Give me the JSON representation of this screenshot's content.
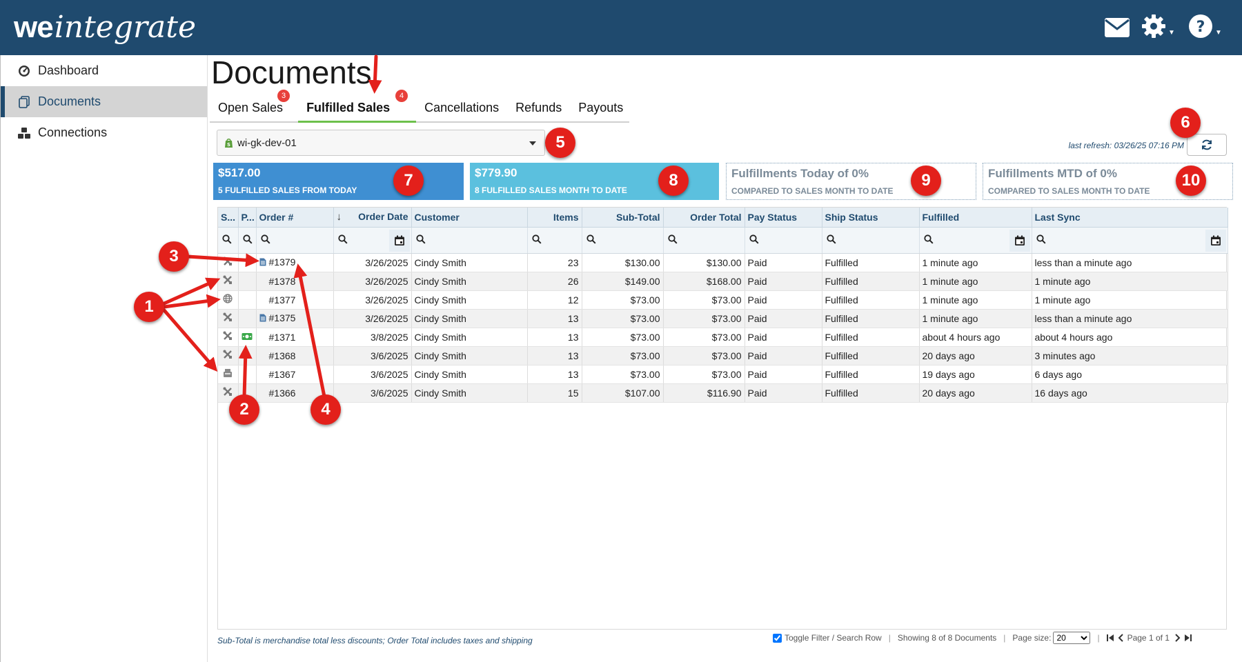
{
  "app": {
    "logo_we": "we",
    "logo_rest": "integrate",
    "icons": {
      "mail": "mail-icon",
      "settings": "gear-icon",
      "help": "help-icon"
    },
    "colors": {
      "brand": "#1f4a6e",
      "accent_green": "#6dc04b",
      "badge_red": "#e8403a"
    }
  },
  "sidebar": {
    "items": [
      {
        "label": "Dashboard",
        "icon": "dashboard-icon"
      },
      {
        "label": "Documents",
        "icon": "documents-icon"
      },
      {
        "label": "Connections",
        "icon": "connections-icon"
      }
    ]
  },
  "page": {
    "title": "Documents"
  },
  "tabs": [
    {
      "label": "Open Sales",
      "badge": "3"
    },
    {
      "label": "Fulfilled Sales",
      "badge": "4"
    },
    {
      "label": "Cancellations"
    },
    {
      "label": "Refunds"
    },
    {
      "label": "Payouts"
    }
  ],
  "store_select": {
    "value": "wi-gk-dev-01",
    "icon": "shopify-icon"
  },
  "refresh": {
    "text": "last refresh: 03/26/25 07:16 PM"
  },
  "kpis": [
    {
      "value": "$517.00",
      "label": "5 FULFILLED SALES FROM TODAY",
      "color": "#3f8fd2"
    },
    {
      "value": "$779.90",
      "label": "8 FULFILLED SALES MONTH TO DATE",
      "color": "#5bc0de"
    },
    {
      "value": "Fulfillments Today of 0%",
      "label": "COMPARED TO SALES MONTH TO DATE"
    },
    {
      "value": "Fulfillments MTD of 0%",
      "label": "COMPARED TO SALES MONTH TO DATE"
    }
  ],
  "table": {
    "columns": [
      "S...",
      "P...",
      "Order #",
      "Order Date",
      "Customer",
      "Items",
      "Sub-Total",
      "Order Total",
      "Pay Status",
      "Ship Status",
      "Fulfilled",
      "Last Sync"
    ],
    "sort_indicator": "↓",
    "rows": [
      {
        "status_icon": "tools-icon",
        "pay_icon": "",
        "has_doc": true,
        "order": "#1379",
        "date": "3/26/2025",
        "customer": "Cindy Smith",
        "items": "23",
        "subtotal": "$130.00",
        "total": "$130.00",
        "pay": "Paid",
        "ship": "Fulfilled",
        "fulfilled": "1 minute ago",
        "sync": "less than a minute ago"
      },
      {
        "status_icon": "tools-icon",
        "pay_icon": "",
        "has_doc": false,
        "order": "#1378",
        "date": "3/26/2025",
        "customer": "Cindy Smith",
        "items": "26",
        "subtotal": "$149.00",
        "total": "$168.00",
        "pay": "Paid",
        "ship": "Fulfilled",
        "fulfilled": "1 minute ago",
        "sync": "1 minute ago"
      },
      {
        "status_icon": "globe-icon",
        "pay_icon": "",
        "has_doc": false,
        "order": "#1377",
        "date": "3/26/2025",
        "customer": "Cindy Smith",
        "items": "12",
        "subtotal": "$73.00",
        "total": "$73.00",
        "pay": "Paid",
        "ship": "Fulfilled",
        "fulfilled": "1 minute ago",
        "sync": "1 minute ago"
      },
      {
        "status_icon": "tools-icon",
        "pay_icon": "",
        "has_doc": true,
        "order": "#1375",
        "date": "3/26/2025",
        "customer": "Cindy Smith",
        "items": "13",
        "subtotal": "$73.00",
        "total": "$73.00",
        "pay": "Paid",
        "ship": "Fulfilled",
        "fulfilled": "1 minute ago",
        "sync": "less than a minute ago"
      },
      {
        "status_icon": "tools-icon",
        "pay_icon": "cash-icon",
        "has_doc": false,
        "order": "#1371",
        "date": "3/8/2025",
        "customer": "Cindy Smith",
        "items": "13",
        "subtotal": "$73.00",
        "total": "$73.00",
        "pay": "Paid",
        "ship": "Fulfilled",
        "fulfilled": "about 4 hours ago",
        "sync": "about 4 hours ago"
      },
      {
        "status_icon": "tools-icon",
        "pay_icon": "",
        "has_doc": false,
        "order": "#1368",
        "date": "3/6/2025",
        "customer": "Cindy Smith",
        "items": "13",
        "subtotal": "$73.00",
        "total": "$73.00",
        "pay": "Paid",
        "ship": "Fulfilled",
        "fulfilled": "20 days ago",
        "sync": "3 minutes ago"
      },
      {
        "status_icon": "pos-icon",
        "pay_icon": "",
        "has_doc": false,
        "order": "#1367",
        "date": "3/6/2025",
        "customer": "Cindy Smith",
        "items": "13",
        "subtotal": "$73.00",
        "total": "$73.00",
        "pay": "Paid",
        "ship": "Fulfilled",
        "fulfilled": "19 days ago",
        "sync": "6 days ago"
      },
      {
        "status_icon": "tools-icon",
        "pay_icon": "",
        "has_doc": false,
        "order": "#1366",
        "date": "3/6/2025",
        "customer": "Cindy Smith",
        "items": "15",
        "subtotal": "$107.00",
        "total": "$116.90",
        "pay": "Paid",
        "ship": "Fulfilled",
        "fulfilled": "20 days ago",
        "sync": "16 days ago"
      }
    ]
  },
  "footer": {
    "note": "Sub-Total is merchandise total less discounts; Order Total includes taxes and shipping",
    "toggle_label": "Toggle Filter / Search Row",
    "showing": "Showing 8 of 8 Documents",
    "page_size_label": "Page size:",
    "page_size_value": "20",
    "page_label": "Page 1 of 1"
  },
  "annotations": [
    "1",
    "2",
    "3",
    "4",
    "5",
    "6",
    "7",
    "8",
    "9",
    "10"
  ]
}
